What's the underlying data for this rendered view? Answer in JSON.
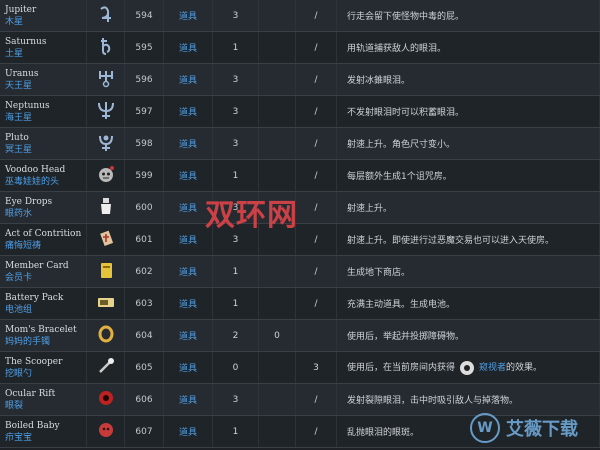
{
  "rows": [
    {
      "en": "Jupiter",
      "zh": "木星",
      "icon": "jupiter-icon",
      "id": "594",
      "link": "道具",
      "q": "3",
      "chg": "",
      "x": "/",
      "desc": "行走会留下使怪物中毒的屁。"
    },
    {
      "en": "Saturnus",
      "zh": "土星",
      "icon": "saturnus-icon",
      "id": "595",
      "link": "道具",
      "q": "1",
      "chg": "",
      "x": "/",
      "desc": "用轨道捕获敌人的眼泪。"
    },
    {
      "en": "Uranus",
      "zh": "天王星",
      "icon": "uranus-icon",
      "id": "596",
      "link": "道具",
      "q": "3",
      "chg": "",
      "x": "/",
      "desc": "发射冰錐眼泪。"
    },
    {
      "en": "Neptunus",
      "zh": "海王星",
      "icon": "neptunus-icon",
      "id": "597",
      "link": "道具",
      "q": "3",
      "chg": "",
      "x": "/",
      "desc": "不发射眼泪时可以积蓄眼泪。"
    },
    {
      "en": "Pluto",
      "zh": "冥王星",
      "icon": "pluto-icon",
      "id": "598",
      "link": "道具",
      "q": "3",
      "chg": "",
      "x": "/",
      "desc": "射速上升。角色尺寸变小。"
    },
    {
      "en": "Voodoo Head",
      "zh": "巫毒娃娃的头",
      "icon": "voodoo-head-icon",
      "id": "599",
      "link": "道具",
      "q": "1",
      "chg": "",
      "x": "/",
      "desc": "每层额外生成1个诅咒房。"
    },
    {
      "en": "Eye Drops",
      "zh": "眼药水",
      "icon": "eye-drops-icon",
      "id": "600",
      "link": "道具",
      "q": "3",
      "chg": "",
      "x": "/",
      "desc": "射速上升。"
    },
    {
      "en": "Act of Contrition",
      "zh": "痛悔短祷",
      "icon": "act-of-contrition-icon",
      "id": "601",
      "link": "道具",
      "q": "3",
      "chg": "",
      "x": "/",
      "desc": "射速上升。即使进行过恶魔交易也可以进入天使房。"
    },
    {
      "en": "Member Card",
      "zh": "会员卡",
      "icon": "member-card-icon",
      "id": "602",
      "link": "道具",
      "q": "1",
      "chg": "",
      "x": "/",
      "desc": "生成地下商店。"
    },
    {
      "en": "Battery Pack",
      "zh": "电池组",
      "icon": "battery-pack-icon",
      "id": "603",
      "link": "道具",
      "q": "1",
      "chg": "",
      "x": "/",
      "desc": "充满主动道具。生成电池。"
    },
    {
      "en": "Mom's Bracelet",
      "zh": "妈妈的手镯",
      "icon": "moms-bracelet-icon",
      "id": "604",
      "link": "道具",
      "q": "2",
      "chg": "0",
      "x": "",
      "desc": "使用后，举起并投掷障碍物。"
    },
    {
      "en": "The Scooper",
      "zh": "挖眼勺",
      "icon": "the-scooper-icon",
      "id": "605",
      "link": "道具",
      "q": "0",
      "chg": "",
      "x": "3",
      "desc_pre": "使用后，在当前房间内获得",
      "desc_link": "窥视者",
      "desc_post": "的效果。"
    },
    {
      "en": "Ocular Rift",
      "zh": "眼裂",
      "icon": "ocular-rift-icon",
      "id": "606",
      "link": "道具",
      "q": "3",
      "chg": "",
      "x": "/",
      "desc": "发射裂隙眼泪，击中时吸引敌人与掉落物。"
    },
    {
      "en": "Boiled Baby",
      "zh": "疖宝宝",
      "icon": "boiled-baby-icon",
      "id": "607",
      "link": "道具",
      "q": "1",
      "chg": "",
      "x": "/",
      "desc": "乱抛眼泪的眼斑。"
    }
  ],
  "watermark": {
    "center": "双环网",
    "corner": "艾薇下载"
  }
}
